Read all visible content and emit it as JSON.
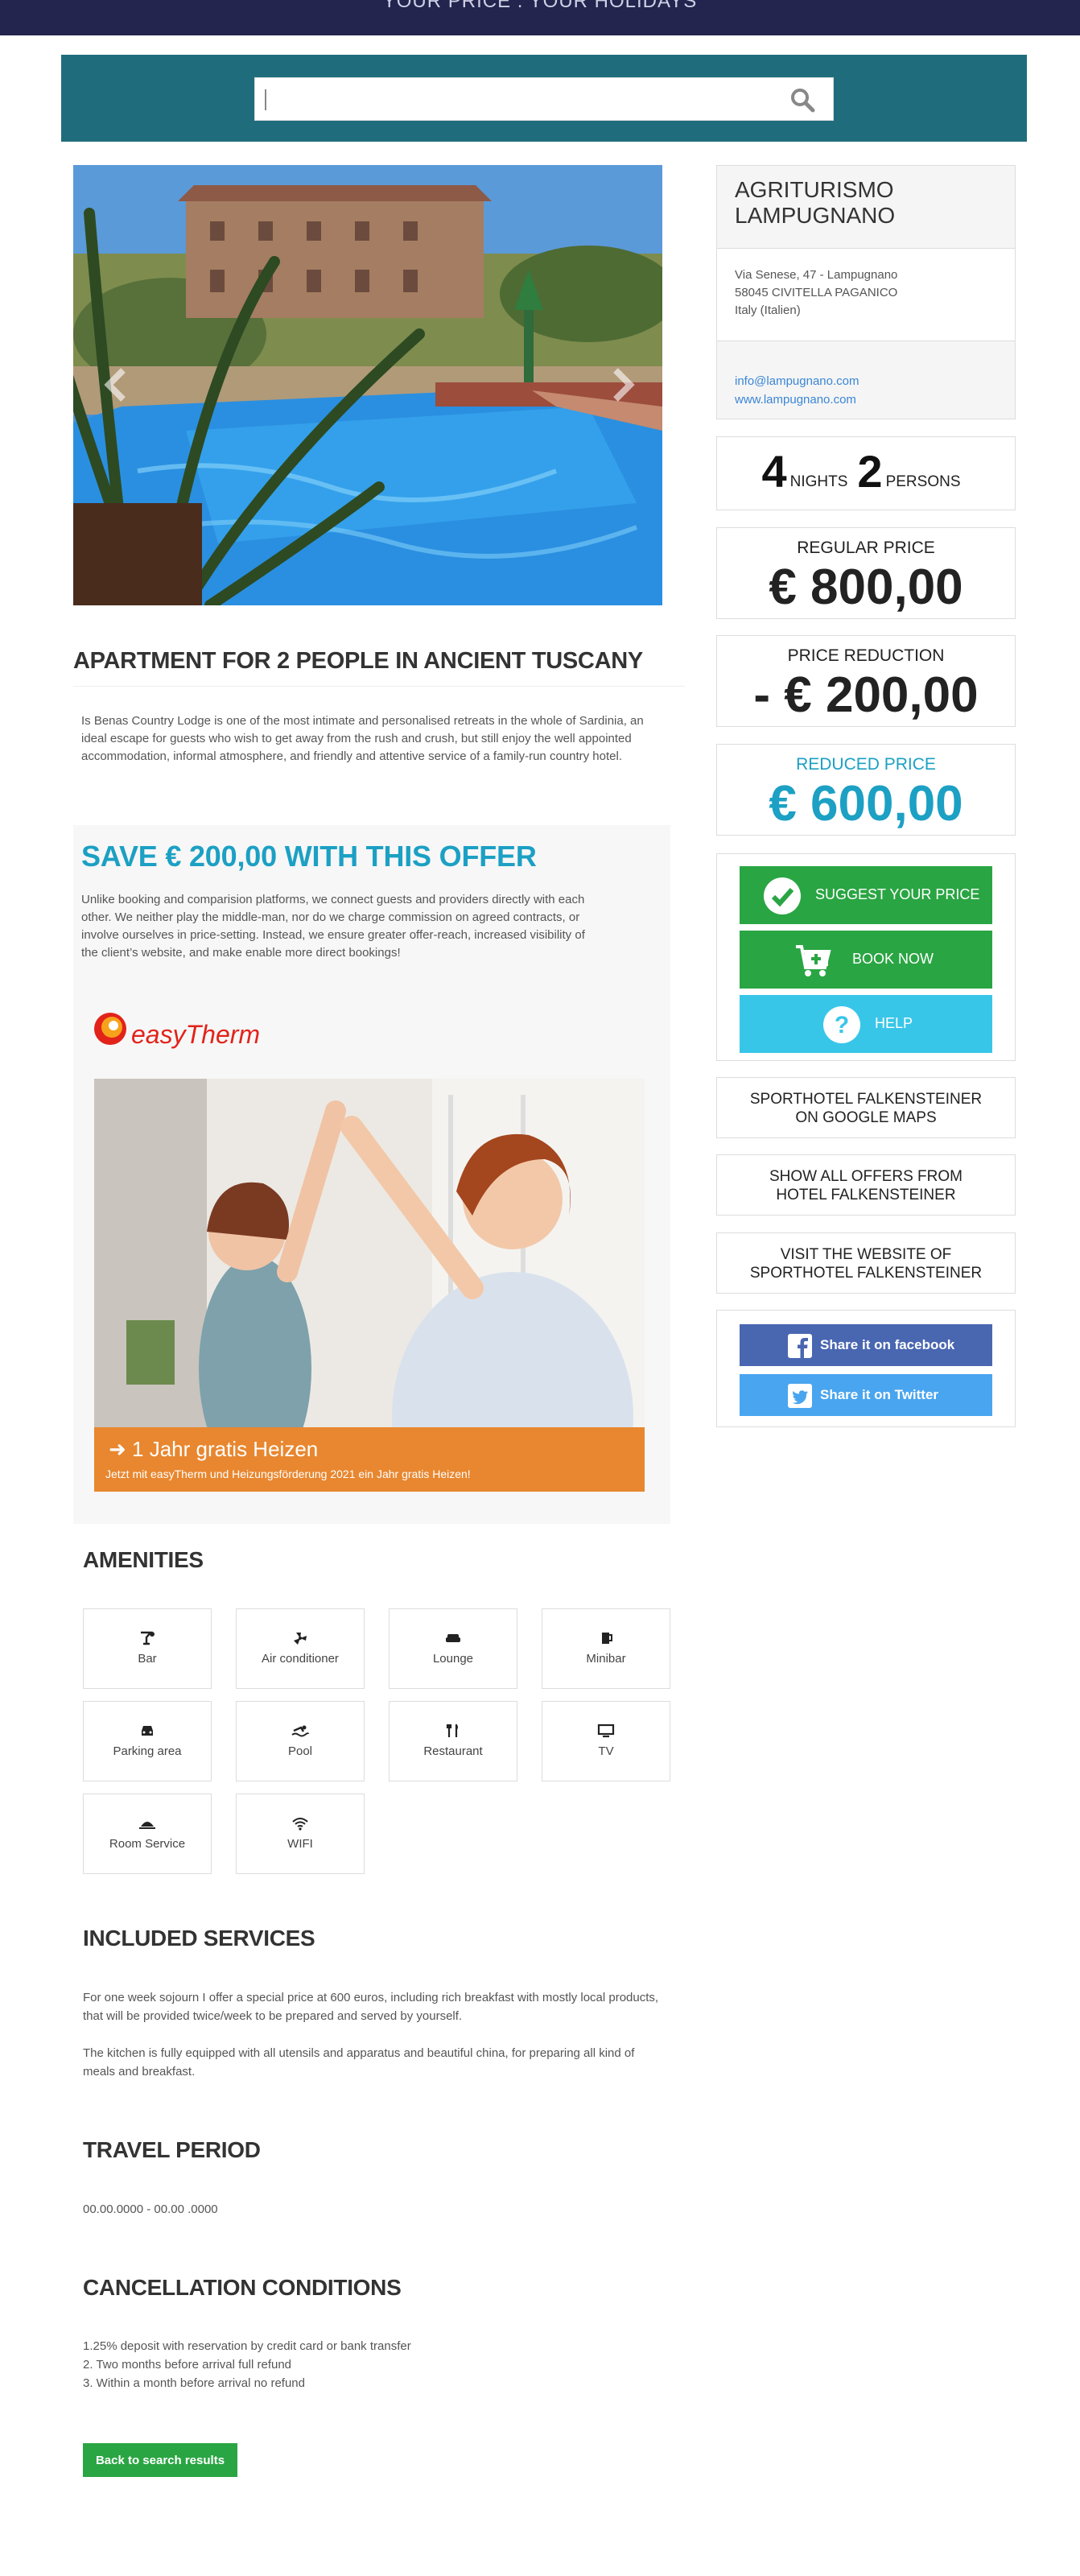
{
  "header": {
    "tagline": "YOUR PRICE . YOUR HOLIDAYS"
  },
  "search": {
    "value": "",
    "placeholder": ""
  },
  "listing": {
    "title": "APARTMENT FOR 2 PEOPLE IN ANCIENT TUSCANY",
    "intro": "Is Benas Country Lodge is one of the most intimate and personalised retreats in the whole of Sardinia, an ideal escape for guests who wish to get away from the rush and crush, but still enjoy the well appointed accommodation, informal atmosphere, and friendly and attentive service of a family-run country hotel."
  },
  "offer": {
    "heading": "SAVE € 200,00 WITH THIS OFFER",
    "text": "Unlike booking and comparision platforms, we connect guests and providers directly with each other. We neither play the middle-man, nor do we charge commission on agreed contracts, or involve ourselves in price-setting. Instead, we ensure greater offer-reach, increased visibility of the client’s website, and make enable more direct bookings!",
    "ad": {
      "brand": "easyTherm",
      "headline": "1 Jahr gratis Heizen",
      "subline": "Jetzt mit easyTherm und Heizungsförderung 2021 ein Jahr gratis Heizen!",
      "band_color": "#e8872f"
    }
  },
  "amenities": {
    "heading": "AMENITIES",
    "items": [
      {
        "label": "Bar",
        "icon": "bar-icon"
      },
      {
        "label": "Air conditioner",
        "icon": "fan-icon"
      },
      {
        "label": "Lounge",
        "icon": "sofa-icon"
      },
      {
        "label": "Minibar",
        "icon": "beer-icon"
      },
      {
        "label": "Parking area",
        "icon": "car-icon"
      },
      {
        "label": "Pool",
        "icon": "swimmer-icon"
      },
      {
        "label": "Restaurant",
        "icon": "cutlery-icon"
      },
      {
        "label": "TV",
        "icon": "tv-icon"
      },
      {
        "label": "Room Service",
        "icon": "cloche-icon"
      },
      {
        "label": "WIFI",
        "icon": "wifi-icon"
      }
    ]
  },
  "services": {
    "heading": "INCLUDED SERVICES",
    "p1": "For one week sojourn I offer a special price at 600 euros, including rich breakfast with mostly local products, that will be provided twice/week to be prepared and served by yourself.",
    "p2": "The kitchen is fully equipped with all utensils and apparatus and beautiful china, for preparing all kind of meals and breakfast."
  },
  "travel": {
    "heading": "TRAVEL PERIOD",
    "dates": "00.00.0000 - 00.00 .0000"
  },
  "cancellation": {
    "heading": "CANCELLATION CONDITIONS",
    "lines": [
      "1.25% deposit with reservation by credit card or bank transfer",
      "2. Two months before arrival full refund",
      "3. Within a month before arrival no refund"
    ]
  },
  "back_button": "Back to search results",
  "hotel": {
    "name_line1": "AGRITURISMO",
    "name_line2": "LAMPUGNANO",
    "address": [
      "Via Senese, 47 - Lampugnano",
      "58045 CIVITELLA PAGANICO",
      "Italy (Italien)"
    ],
    "email": "info@lampugnano.com",
    "website": "www.lampugnano.com"
  },
  "stay": {
    "nights": "4",
    "nights_label": "NIGHTS",
    "persons": "2",
    "persons_label": "PERSONS"
  },
  "prices": {
    "regular_label": "REGULAR PRICE",
    "regular": "€ 800,00",
    "reduction_label": "PRICE REDUCTION",
    "reduction": "- € 200,00",
    "reduced_label": "REDUCED PRICE",
    "reduced": "€ 600,00",
    "reduced_color": "#1ca0c4"
  },
  "actions": {
    "suggest": "SUGGEST YOUR PRICE",
    "book": "BOOK NOW",
    "help": "HELP"
  },
  "links": {
    "maps_l1": "SPORTHOTEL FALKENSTEINER",
    "maps_l2": "ON GOOGLE MAPS",
    "offers_l1": "SHOW ALL OFFERS FROM",
    "offers_l2": "HOTEL FALKENSTEINER",
    "site_l1": "VISIT THE WEBSITE OF",
    "site_l2": "SPORTHOTEL FALKENSTEINER"
  },
  "share": {
    "facebook": "Share it on facebook",
    "twitter": "Share it on Twitter"
  },
  "colors": {
    "nav": "#23254e",
    "search_band": "#1f6d7c",
    "green": "#2aa543",
    "cyan": "#38c6e8",
    "facebook": "#4966b1",
    "twitter": "#49a5ef"
  }
}
